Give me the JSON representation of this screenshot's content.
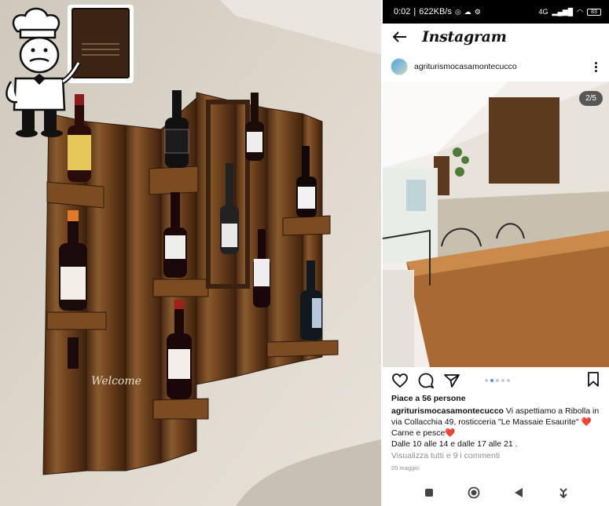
{
  "status_bar": {
    "time": "0:02",
    "network_speed": "622KB/s",
    "signal_label": "4G",
    "battery": "83"
  },
  "header": {
    "app_title": "Instagram",
    "back_icon": "arrow-left-icon"
  },
  "post": {
    "username": "agriturismocasamontecucco",
    "slide_counter": "2/5",
    "likes": "Piace a 56 persone",
    "caption_user": "agriturismocasamontecucco",
    "caption_line1": "Vi aspettiamo a Ribolla in via Collacchia 49, rosticceria \"Le Massaie Esaurite\" ❤️",
    "caption_line2": "Carne e pesce❤️",
    "caption_line3": "Dalle 10 alle 14 e dalle 17 alle 21 .",
    "view_comments": "Visualizza tutti e 9 i commenti",
    "date": "20 maggio",
    "active_dot": 1,
    "dot_count": 5
  },
  "overlay": {
    "welcome_sign": "Welcome"
  },
  "colors": {
    "wall": "#d9d3c8",
    "wood": "#7a4a22",
    "ig_blue": "#3897f0"
  }
}
